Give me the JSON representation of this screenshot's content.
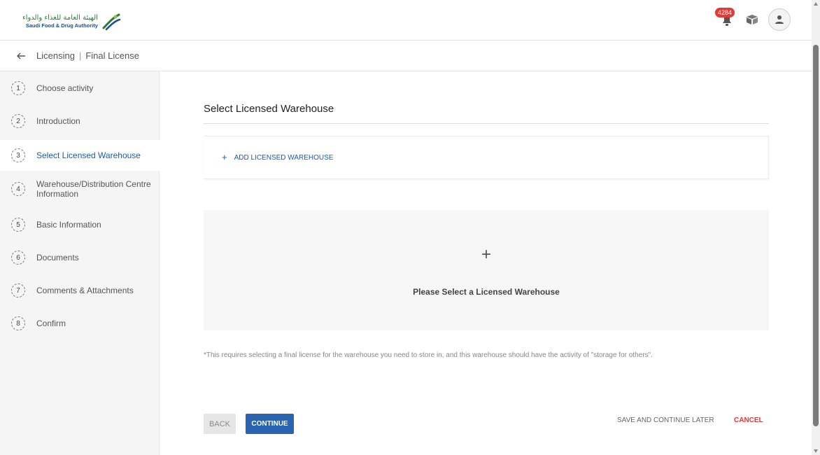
{
  "header": {
    "logo_ar": "الهيئة العامة للغذاء والدواء",
    "logo_en": "Saudi Food & Drug Authority",
    "notification_count": "4284",
    "icons": [
      "bell-icon",
      "package-icon",
      "user-icon"
    ]
  },
  "breadcrumb": {
    "section": "Licensing",
    "page": "Final License"
  },
  "sidebar": {
    "steps": [
      {
        "num": "1",
        "label": "Choose activity"
      },
      {
        "num": "2",
        "label": "Introduction"
      },
      {
        "num": "3",
        "label": "Select Licensed Warehouse"
      },
      {
        "num": "4",
        "label": "Warehouse/Distribution Centre Information"
      },
      {
        "num": "5",
        "label": "Basic Information"
      },
      {
        "num": "6",
        "label": "Documents"
      },
      {
        "num": "7",
        "label": "Comments & Attachments"
      },
      {
        "num": "8",
        "label": "Confirm"
      }
    ],
    "active_step": 3
  },
  "main": {
    "title": "Select Licensed Warehouse",
    "add_link": "ADD LICENSED WAREHOUSE",
    "empty_plus": "+",
    "empty_text": "Please Select a Licensed Warehouse",
    "note": "*This requires selecting a final license for the warehouse you need to store in, and this warehouse should have the activity of \"storage for others\"."
  },
  "footer": {
    "back": "BACK",
    "continue": "CONTINUE",
    "save_later": "SAVE AND CONTINUE LATER",
    "cancel": "CANCEL"
  },
  "colors": {
    "accent": "#2a63b0",
    "cancel": "#e53935",
    "badge": "#e53935",
    "sidebar_bg": "#f5f5f5"
  }
}
